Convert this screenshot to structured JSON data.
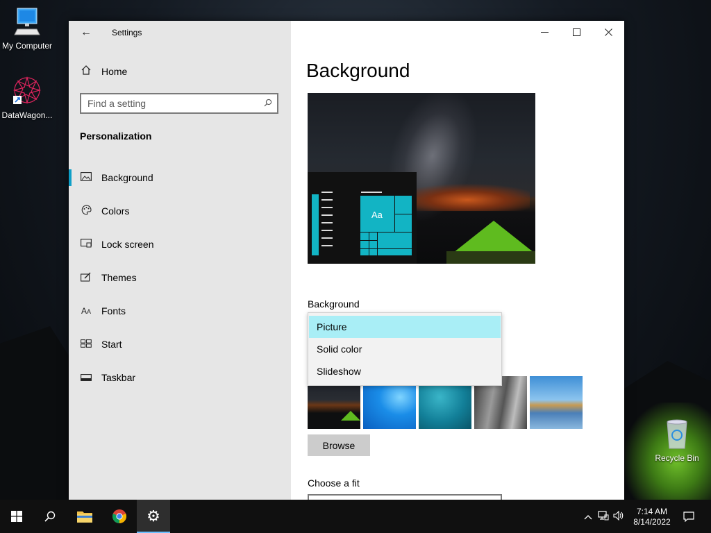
{
  "desktop": {
    "icons": [
      {
        "label": "My Computer"
      },
      {
        "label": "DataWagon..."
      },
      {
        "label": "Recycle Bin"
      }
    ]
  },
  "window": {
    "title": "Settings",
    "controls": {
      "minimize": "—",
      "maximize": "☐",
      "close": "✕"
    }
  },
  "sidebar": {
    "home_label": "Home",
    "search_placeholder": "Find a setting",
    "section_title": "Personalization",
    "items": [
      {
        "label": "Background",
        "icon": "picture-icon",
        "selected": true
      },
      {
        "label": "Colors",
        "icon": "palette-icon",
        "selected": false
      },
      {
        "label": "Lock screen",
        "icon": "lock-screen-icon",
        "selected": false
      },
      {
        "label": "Themes",
        "icon": "themes-icon",
        "selected": false
      },
      {
        "label": "Fonts",
        "icon": "fonts-icon",
        "selected": false
      },
      {
        "label": "Start",
        "icon": "start-icon",
        "selected": false
      },
      {
        "label": "Taskbar",
        "icon": "taskbar-icon",
        "selected": false
      }
    ]
  },
  "main": {
    "page_title": "Background",
    "preview_tile_text": "Aa",
    "background_label": "Background",
    "dropdown_options": [
      {
        "label": "Picture",
        "selected": true
      },
      {
        "label": "Solid color",
        "selected": false
      },
      {
        "label": "Slideshow",
        "selected": false
      }
    ],
    "browse_label": "Browse",
    "fit_label": "Choose a fit"
  },
  "taskbar": {
    "clock_time": "7:14 AM",
    "clock_date": "8/14/2022"
  },
  "colors": {
    "accent": "#0f9fc7",
    "tile_accent": "#12b4c4",
    "dropdown_selected": "#a9eef6"
  }
}
